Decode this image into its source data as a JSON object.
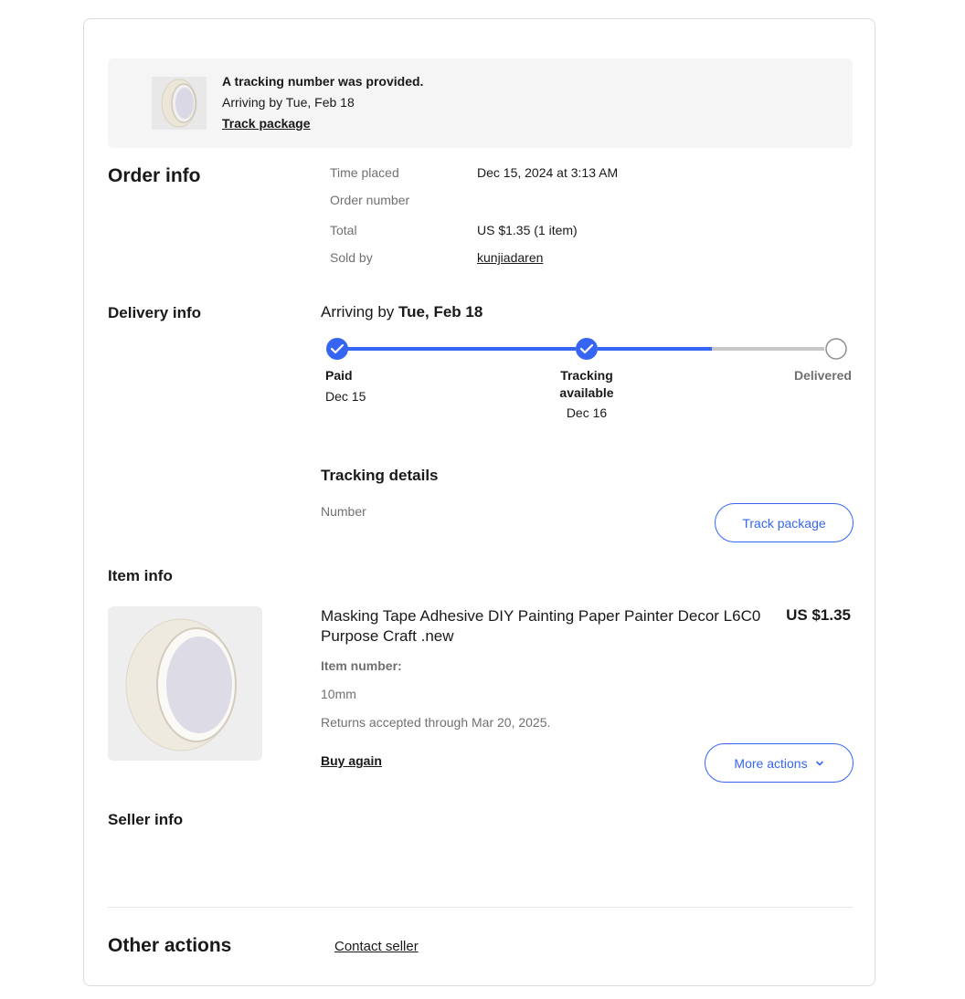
{
  "banner": {
    "headline": "A tracking number was provided.",
    "arrival": "Arriving by Tue, Feb 18",
    "track_link": "Track package"
  },
  "order_info": {
    "title": "Order info",
    "time_placed_label": "Time placed",
    "time_placed_value": "Dec 15, 2024 at 3:13 AM",
    "order_number_label": "Order number",
    "total_label": "Total",
    "total_value": "US $1.35 (1 item)",
    "sold_by_label": "Sold by",
    "sold_by_value": "kunjiadaren"
  },
  "delivery_info": {
    "title": "Delivery info",
    "arriving_prefix": "Arriving by ",
    "arriving_date": "Tue, Feb 18",
    "steps": [
      {
        "label": "Paid",
        "date": "Dec 15"
      },
      {
        "label": "Tracking available",
        "date": "Dec 16"
      },
      {
        "label": "Delivered",
        "date": ""
      }
    ],
    "colors": {
      "active": "#3665f3",
      "inactive": "#c7c7c7"
    },
    "tracking_title": "Tracking details",
    "number_label": "Number",
    "track_button": "Track package"
  },
  "item_info": {
    "title": "Item info",
    "item_title": "Masking Tape Adhesive DIY Painting Paper Painter Decor L6C0 Purpose Craft .new",
    "price": "US $1.35",
    "item_number_label": "Item number:",
    "variant": "10mm",
    "returns": "Returns accepted through Mar 20, 2025.",
    "buy_again": "Buy again",
    "more_actions": "More actions"
  },
  "seller_info": {
    "title": "Seller info"
  },
  "other_actions": {
    "title": "Other actions",
    "contact_seller": "Contact seller"
  }
}
